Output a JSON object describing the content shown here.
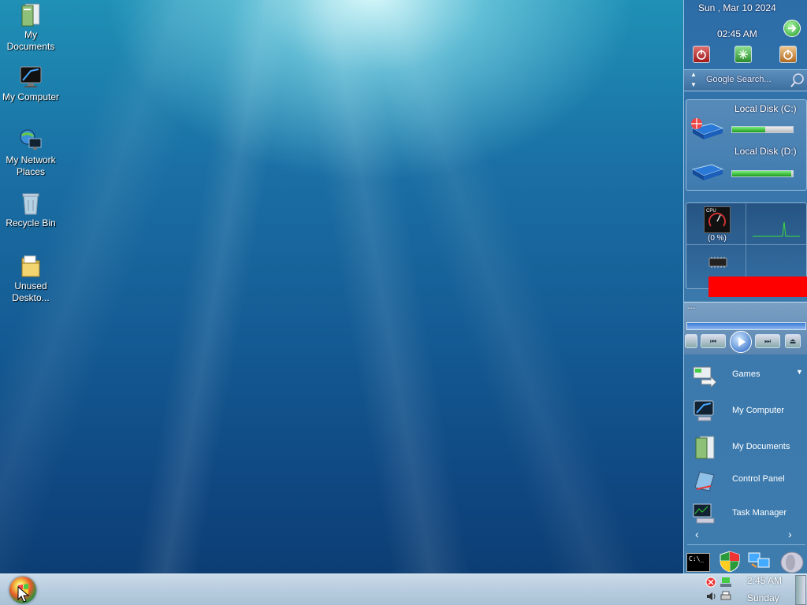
{
  "desktop": {
    "icons": [
      {
        "label_line1": "My",
        "label_line2": "Documents",
        "icon": "my-documents-icon"
      },
      {
        "label_line1": "My Computer",
        "label_line2": "",
        "icon": "my-computer-icon"
      },
      {
        "label_line1": "My Network",
        "label_line2": "Places",
        "icon": "network-places-icon"
      },
      {
        "label_line1": "Recycle Bin",
        "label_line2": "",
        "icon": "recycle-bin-icon"
      },
      {
        "label_line1": "Unused",
        "label_line2": "Deskto...",
        "icon": "folder-icon"
      }
    ]
  },
  "sidebar": {
    "date": "Sun , Mar 10 2024",
    "time": "02:45 AM",
    "search_placeholder": "Google Search...",
    "disks": [
      {
        "name": "Local Disk (C:)",
        "used_fraction": 0.55
      },
      {
        "name": "Local Disk (D:)",
        "used_fraction": 0.98
      }
    ],
    "cpu": {
      "label": "CPU",
      "percent_text": "(0 %)"
    },
    "media": {
      "track_text": "---"
    },
    "menu": [
      {
        "label": "Games",
        "icon": "games-icon",
        "has_dropdown": true
      },
      {
        "label": "My Computer",
        "icon": "my-computer-icon"
      },
      {
        "label": "My Documents",
        "icon": "my-documents-icon"
      },
      {
        "label": "Control Panel",
        "icon": "control-panel-icon"
      },
      {
        "label": "Task Manager",
        "icon": "task-manager-icon"
      }
    ],
    "bottom_icons": [
      "command-prompt-icon",
      "security-shield-icon",
      "network-icon",
      "speaker-icon"
    ]
  },
  "taskbar": {
    "clock_time": "2:45 AM",
    "clock_day": "Sunday"
  },
  "colors": {
    "highlight_red": "#ff0000",
    "cpu_graph_green": "#3cdc3c",
    "disk_fill_green": "#1a9a1a"
  }
}
